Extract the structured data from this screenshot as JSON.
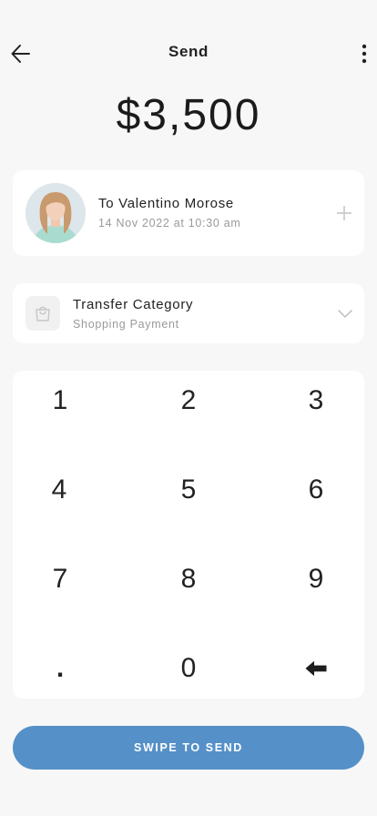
{
  "header": {
    "title": "Send"
  },
  "amount": "$3,500",
  "recipient": {
    "name": "To Valentino Morose",
    "date": "14 Nov 2022 at 10:30 am"
  },
  "category": {
    "title": "Transfer Category",
    "value": "Shopping Payment"
  },
  "keypad": {
    "k1": "1",
    "k2": "2",
    "k3": "3",
    "k4": "4",
    "k5": "5",
    "k6": "6",
    "k7": "7",
    "k8": "8",
    "k9": "9",
    "dot": ".",
    "k0": "0"
  },
  "swipe_label": "SWIPE TO SEND",
  "colors": {
    "accent": "#5590c8",
    "background": "#f7f7f7",
    "card": "#ffffff"
  }
}
